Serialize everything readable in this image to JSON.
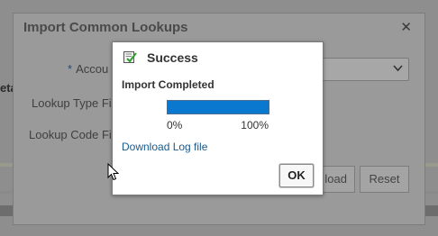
{
  "background": {
    "edge_text": "eta"
  },
  "import_dialog": {
    "title": "Import Common Lookups",
    "close_glyph": "✕",
    "account_required_mark": "*",
    "account_label": "Accou",
    "lookup_type_label": "Lookup Type Fi",
    "lookup_code_label": "Lookup Code Fi",
    "upload_button_label": "load",
    "reset_button_label": "Reset"
  },
  "success_dialog": {
    "title": "Success",
    "icon": "success-check-icon",
    "status_text": "Import Completed",
    "progress": 1.0,
    "progress_min_label": "0%",
    "progress_max_label": "100%",
    "download_link_text": "Download Log file",
    "ok_button_label": "OK"
  },
  "colors": {
    "progress_fill": "#0b78d0",
    "link": "#1a5a8c",
    "overlay": "#8e8e8e"
  }
}
